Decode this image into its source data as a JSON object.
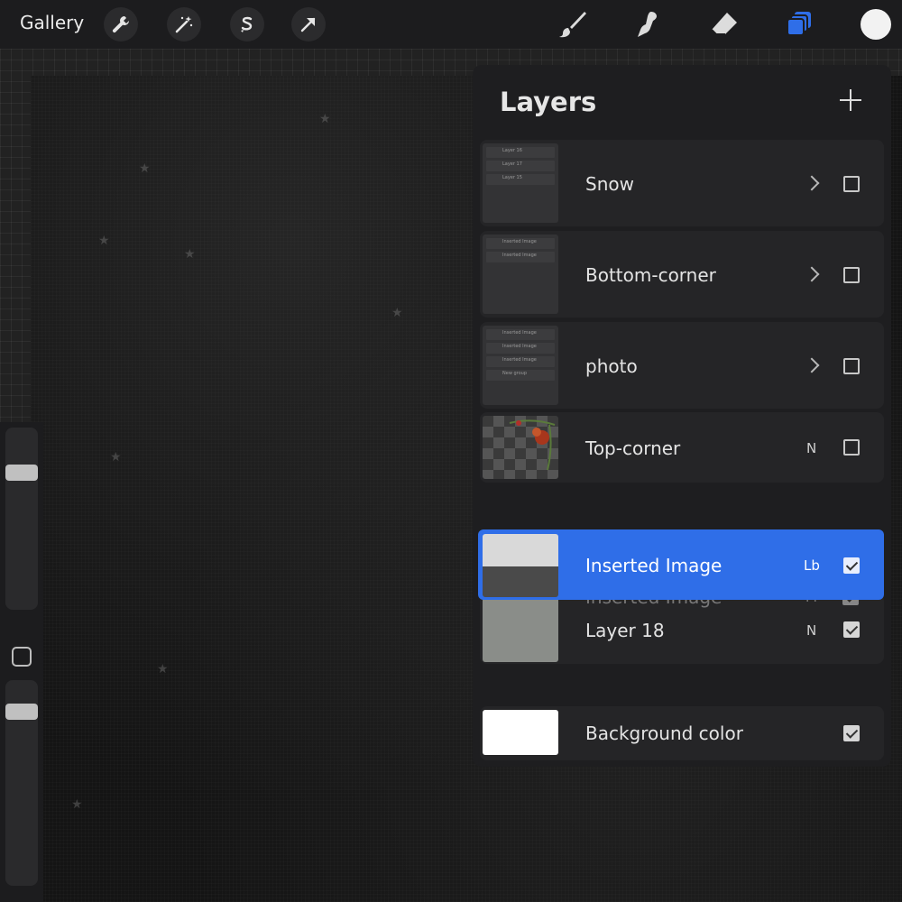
{
  "toolbar": {
    "gallery_label": "Gallery",
    "left_tools": [
      "wrench-icon",
      "magic-wand-icon",
      "selection-s-icon",
      "arrow-cursor-icon"
    ],
    "right_tools": [
      "brush-icon",
      "smudge-icon",
      "eraser-icon",
      "layers-icon"
    ],
    "active_tool": "layers-icon",
    "accent_color": "#2f6ee8",
    "current_color": "#f2f2f2"
  },
  "panel": {
    "title": "Layers",
    "add_icon": "plus-icon",
    "layers": [
      {
        "name": "Snow",
        "type": "group",
        "visible": false,
        "sub_items": [
          "Layer 16",
          "Layer 17",
          "Layer 15"
        ]
      },
      {
        "name": "Bottom-corner",
        "type": "group",
        "visible": false,
        "sub_items": [
          "Inserted Image",
          "Inserted Image"
        ]
      },
      {
        "name": "photo",
        "type": "group",
        "visible": false,
        "sub_items": [
          "Inserted Image",
          "Inserted Image",
          "Inserted Image",
          "New group"
        ]
      },
      {
        "name": "Top-corner",
        "type": "layer",
        "mode": "N",
        "visible": false
      },
      {
        "name": "Inserted Image",
        "type": "layer",
        "mode": "Lb",
        "visible": true,
        "selected": true
      },
      {
        "name": "Inserted Image",
        "type": "layer",
        "mode": "M",
        "visible": true
      },
      {
        "name": "Layer 18",
        "type": "layer",
        "mode": "N",
        "visible": true
      },
      {
        "name": "Background color",
        "type": "background",
        "visible": true
      }
    ]
  }
}
